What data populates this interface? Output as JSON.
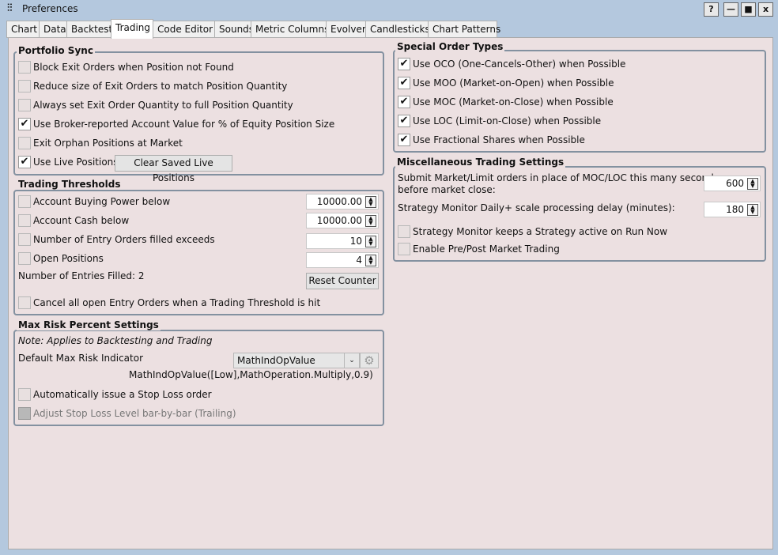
{
  "window": {
    "title": "Preferences",
    "help": "?",
    "minimize": "—",
    "maximize": "■",
    "close": "x"
  },
  "tabs": [
    "Chart",
    "Data",
    "Backtest",
    "Trading",
    "Code Editor",
    "Sounds",
    "Metric Columns",
    "Evolver",
    "Candlesticks",
    "Chart Patterns"
  ],
  "active_tab": "Trading",
  "portfolio_sync": {
    "title": "Portfolio Sync",
    "items": [
      {
        "label": "Block Exit Orders when Position not Found",
        "checked": false
      },
      {
        "label": "Reduce size of Exit Orders to match Position Quantity",
        "checked": false
      },
      {
        "label": "Always set Exit Order Quantity to full Position Quantity",
        "checked": false
      },
      {
        "label": "Use Broker-reported Account Value for % of Equity Position Size",
        "checked": true
      },
      {
        "label": "Exit Orphan Positions at Market",
        "checked": false
      },
      {
        "label": "Use Live Positions",
        "checked": true
      }
    ],
    "clear_button": "Clear Saved Live Positions"
  },
  "trading_thresholds": {
    "title": "Trading Thresholds",
    "items": [
      {
        "label": "Account Buying Power below",
        "value": "10000.00",
        "checked": false
      },
      {
        "label": "Account Cash below",
        "value": "10000.00",
        "checked": false
      },
      {
        "label": "Number of Entry Orders filled exceeds",
        "value": "10",
        "checked": false
      },
      {
        "label": "Open Positions",
        "value": "4",
        "checked": false
      }
    ],
    "entries_filled": "Number of Entries Filled: 2",
    "reset_button": "Reset Counter",
    "cancel_label": "Cancel all open Entry Orders when a Trading Threshold is hit"
  },
  "max_risk": {
    "title": "Max Risk Percent Settings",
    "note": "Note: Applies to Backtesting and Trading",
    "indicator_label": "Default Max Risk Indicator",
    "indicator_value": "MathIndOpValue",
    "expression": "MathIndOpValue([Low],MathOperation.Multiply,0.9)",
    "stop_loss": "Automatically issue a Stop Loss order",
    "trailing": "Adjust Stop Loss Level bar-by-bar (Trailing)"
  },
  "special_orders": {
    "title": "Special Order Types",
    "items": [
      {
        "label": "Use OCO (One-Cancels-Other) when Possible",
        "checked": true
      },
      {
        "label": "Use MOO (Market-on-Open) when Possible",
        "checked": true
      },
      {
        "label": "Use MOC (Market-on-Close) when Possible",
        "checked": true
      },
      {
        "label": "Use LOC (Limit-on-Close) when Possible",
        "checked": true
      },
      {
        "label": "Use Fractional Shares when Possible",
        "checked": true
      }
    ]
  },
  "misc": {
    "title": "Miscellaneous Trading Settings",
    "submit_label_1": "Submit Market/Limit orders in place of MOC/LOC this many seconds",
    "submit_label_2": "before market close:",
    "submit_value": "600",
    "delay_label": "Strategy Monitor Daily+ scale processing delay (minutes):",
    "delay_value": "180",
    "keep_active": "Strategy Monitor keeps a Strategy active on Run Now",
    "prepost": "Enable Pre/Post Market Trading"
  }
}
